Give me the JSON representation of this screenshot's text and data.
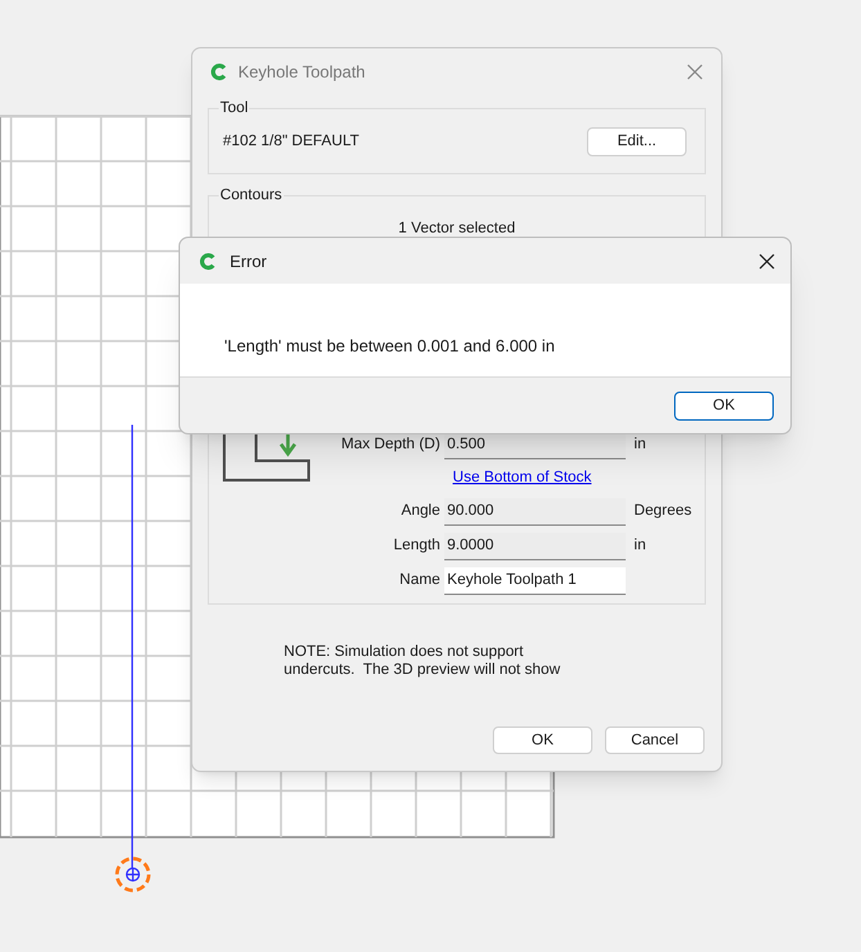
{
  "main_dialog": {
    "title": "Keyhole Toolpath",
    "tool_group": {
      "title": "Tool",
      "tool_name": "#102 1/8\" DEFAULT",
      "edit_button": "Edit..."
    },
    "contours_group": {
      "title": "Contours",
      "selection": "1 Vector selected",
      "fields": [
        {
          "label": "Max Depth (D)",
          "value": "0.500",
          "unit": "in",
          "kind": "number"
        },
        {
          "kind": "link",
          "text": "Use Bottom of Stock"
        },
        {
          "label": "Angle",
          "value": "90.000",
          "unit": "Degrees",
          "kind": "number"
        },
        {
          "label": "Length",
          "value": "9.0000",
          "unit": "in",
          "kind": "number"
        },
        {
          "label": "Name",
          "value": "Keyhole Toolpath 1",
          "kind": "text"
        }
      ]
    },
    "note": "NOTE: Simulation does not support undercuts.  The 3D preview will not show",
    "buttons": [
      "OK",
      "Cancel"
    ]
  },
  "error_dialog": {
    "title": "Error",
    "message": "'Length' must be between 0.001 and 6.000 in",
    "button": "OK"
  }
}
